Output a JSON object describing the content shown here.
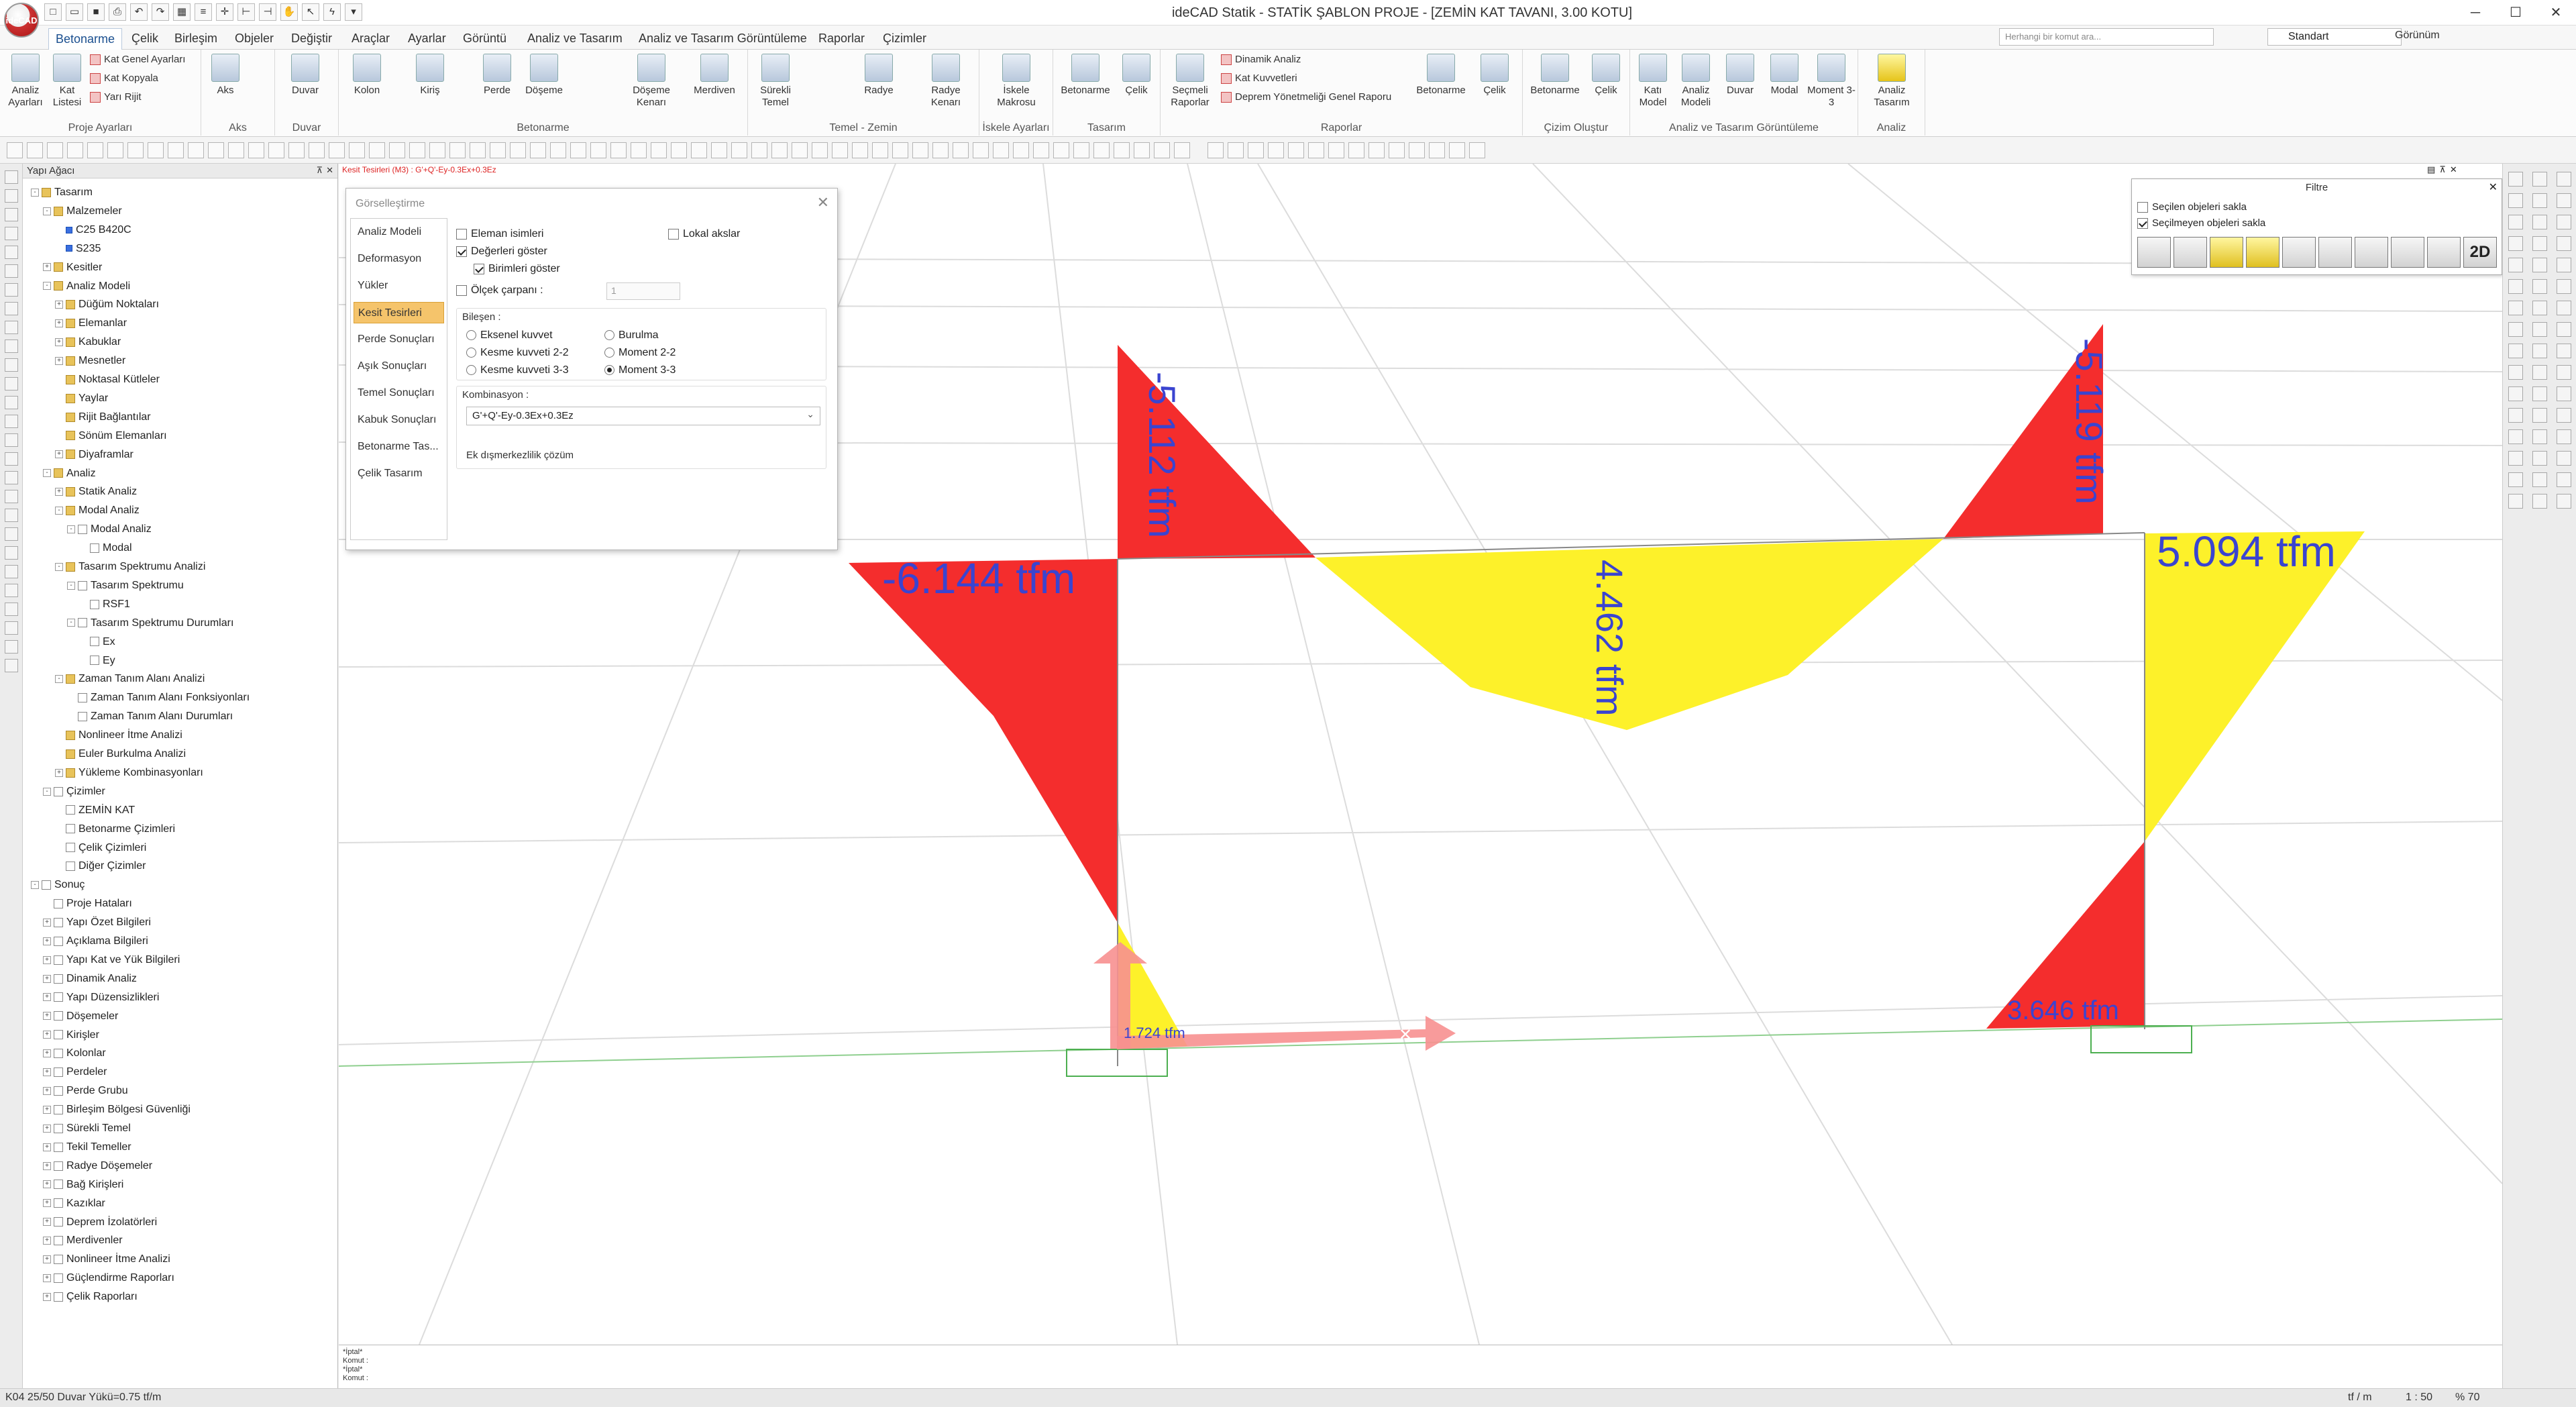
{
  "app": {
    "title": "ideCAD Statik - STATİK ŞABLON PROJE - [ZEMİN KAT TAVANI,  3.00 KOTU]",
    "logo_text": "ideCAD"
  },
  "menu": {
    "tabs": [
      "Betonarme",
      "Çelik",
      "Birleşim",
      "Objeler",
      "Değiştir",
      "Araçlar",
      "Ayarlar",
      "Görüntü",
      "Analiz ve Tasarım",
      "Analiz ve Tasarım Görüntüleme",
      "Raporlar",
      "Çizimler"
    ],
    "active": "Betonarme",
    "search_placeholder": "Herhangi bir komut ara...",
    "profile": "Standart",
    "view_label": "Görünüm"
  },
  "ribbon": {
    "groups": [
      {
        "label": "Proje Ayarları",
        "buttons": [
          "Analiz Ayarları",
          "Kat Listesi"
        ],
        "small": [
          "Kat Genel Ayarları",
          "Kat Kopyala",
          "Yarı Rijit"
        ]
      },
      {
        "label": "Aks",
        "buttons": [
          "Aks"
        ]
      },
      {
        "label": "Duvar",
        "buttons": [
          "Duvar"
        ]
      },
      {
        "label": "Betonarme",
        "buttons": [
          "Kolon",
          "Kiriş",
          "Perde",
          "Döşeme",
          "Döşeme Kenarı",
          "Merdiven"
        ]
      },
      {
        "label": "Temel - Zemin",
        "buttons": [
          "Sürekli Temel",
          "Radye",
          "Radye Kenarı"
        ]
      },
      {
        "label": "İskele Ayarları",
        "buttons": [
          "İskele Makrosu"
        ]
      },
      {
        "label": "Tasarım",
        "buttons": [
          "Betonarme",
          "Çelik"
        ]
      },
      {
        "label": "Raporlar",
        "buttons": [
          "Seçmeli Raporlar",
          "Betonarme",
          "Çelik"
        ],
        "small": [
          "Dinamik Analiz",
          "Kat Kuvvetleri",
          "Deprem Yönetmeliği Genel Raporu"
        ]
      },
      {
        "label": "Çizim Oluştur",
        "buttons": [
          "Betonarme",
          "Çelik"
        ]
      },
      {
        "label": "Analiz ve Tasarım Görüntüleme",
        "buttons": [
          "Katı Model",
          "Analiz Modeli",
          "Duvar",
          "Modal",
          "Moment 3-3"
        ]
      },
      {
        "label": "Analiz",
        "buttons": [
          "Analiz Tasarım"
        ]
      }
    ]
  },
  "tree": {
    "title": "Yapı Ağacı",
    "items": [
      {
        "label": "Tasarım",
        "level": 0,
        "toggle": "-",
        "icon": "folder"
      },
      {
        "label": "Malzemeler",
        "level": 1,
        "toggle": "-",
        "icon": "folder"
      },
      {
        "label": "C25 B420C",
        "level": 2,
        "toggle": "",
        "icon": "blue"
      },
      {
        "label": "S235",
        "level": 2,
        "toggle": "",
        "icon": "blue"
      },
      {
        "label": "Kesitler",
        "level": 1,
        "toggle": "+",
        "icon": "folder"
      },
      {
        "label": "Analiz Modeli",
        "level": 1,
        "toggle": "-",
        "icon": "folder"
      },
      {
        "label": "Düğüm Noktaları",
        "level": 2,
        "toggle": "+",
        "icon": "folder"
      },
      {
        "label": "Elemanlar",
        "level": 2,
        "toggle": "+",
        "icon": "folder"
      },
      {
        "label": "Kabuklar",
        "level": 2,
        "toggle": "+",
        "icon": "folder"
      },
      {
        "label": "Mesnetler",
        "level": 2,
        "toggle": "+",
        "icon": "folder"
      },
      {
        "label": "Noktasal Kütleler",
        "level": 2,
        "toggle": "",
        "icon": "folder"
      },
      {
        "label": "Yaylar",
        "level": 2,
        "toggle": "",
        "icon": "folder"
      },
      {
        "label": "Rijit Bağlantılar",
        "level": 2,
        "toggle": "",
        "icon": "folder"
      },
      {
        "label": "Sönüm Elemanları",
        "level": 2,
        "toggle": "",
        "icon": "folder"
      },
      {
        "label": "Diyaframlar",
        "level": 2,
        "toggle": "+",
        "icon": "folder"
      },
      {
        "label": "Analiz",
        "level": 1,
        "toggle": "-",
        "icon": "folder"
      },
      {
        "label": "Statik Analiz",
        "level": 2,
        "toggle": "+",
        "icon": "folder"
      },
      {
        "label": "Modal Analiz",
        "level": 2,
        "toggle": "-",
        "icon": "folder"
      },
      {
        "label": "Modal Analiz",
        "level": 3,
        "toggle": "-",
        "icon": "doc"
      },
      {
        "label": "Modal",
        "level": 4,
        "toggle": "",
        "icon": "doc"
      },
      {
        "label": "Tasarım Spektrumu Analizi",
        "level": 2,
        "toggle": "-",
        "icon": "folder"
      },
      {
        "label": "Tasarım Spektrumu",
        "level": 3,
        "toggle": "-",
        "icon": "doc"
      },
      {
        "label": "RSF1",
        "level": 4,
        "toggle": "",
        "icon": "doc"
      },
      {
        "label": "Tasarım Spektrumu Durumları",
        "level": 3,
        "toggle": "-",
        "icon": "doc"
      },
      {
        "label": "Ex",
        "level": 4,
        "toggle": "",
        "icon": "doc"
      },
      {
        "label": "Ey",
        "level": 4,
        "toggle": "",
        "icon": "doc"
      },
      {
        "label": "Zaman Tanım Alanı Analizi",
        "level": 2,
        "toggle": "-",
        "icon": "folder"
      },
      {
        "label": "Zaman Tanım Alanı Fonksiyonları",
        "level": 3,
        "toggle": "",
        "icon": "doc"
      },
      {
        "label": "Zaman Tanım Alanı Durumları",
        "level": 3,
        "toggle": "",
        "icon": "doc"
      },
      {
        "label": "Nonlineer İtme Analizi",
        "level": 2,
        "toggle": "",
        "icon": "folder"
      },
      {
        "label": "Euler Burkulma Analizi",
        "level": 2,
        "toggle": "",
        "icon": "folder"
      },
      {
        "label": "Yükleme Kombinasyonları",
        "level": 2,
        "toggle": "+",
        "icon": "folder"
      },
      {
        "label": "Çizimler",
        "level": 1,
        "toggle": "-",
        "icon": "doc"
      },
      {
        "label": "ZEMİN KAT",
        "level": 2,
        "toggle": "",
        "icon": "doc"
      },
      {
        "label": "Betonarme Çizimleri",
        "level": 2,
        "toggle": "",
        "icon": "doc"
      },
      {
        "label": "Çelik Çizimleri",
        "level": 2,
        "toggle": "",
        "icon": "doc"
      },
      {
        "label": "Diğer Çizimler",
        "level": 2,
        "toggle": "",
        "icon": "doc"
      },
      {
        "label": "Sonuç",
        "level": 0,
        "toggle": "-",
        "icon": "doc"
      },
      {
        "label": "Proje Hataları",
        "level": 1,
        "toggle": "",
        "icon": "doc"
      },
      {
        "label": "Yapı Özet Bilgileri",
        "level": 1,
        "toggle": "+",
        "icon": "doc"
      },
      {
        "label": "Açıklama Bilgileri",
        "level": 1,
        "toggle": "+",
        "icon": "doc"
      },
      {
        "label": "Yapı Kat ve Yük Bilgileri",
        "level": 1,
        "toggle": "+",
        "icon": "doc"
      },
      {
        "label": "Dinamik Analiz",
        "level": 1,
        "toggle": "+",
        "icon": "doc"
      },
      {
        "label": "Yapı Düzensizlikleri",
        "level": 1,
        "toggle": "+",
        "icon": "doc"
      },
      {
        "label": "Döşemeler",
        "level": 1,
        "toggle": "+",
        "icon": "doc"
      },
      {
        "label": "Kirişler",
        "level": 1,
        "toggle": "+",
        "icon": "doc"
      },
      {
        "label": "Kolonlar",
        "level": 1,
        "toggle": "+",
        "icon": "doc"
      },
      {
        "label": "Perdeler",
        "level": 1,
        "toggle": "+",
        "icon": "doc"
      },
      {
        "label": "Perde Grubu",
        "level": 1,
        "toggle": "+",
        "icon": "doc"
      },
      {
        "label": "Birleşim Bölgesi Güvenliği",
        "level": 1,
        "toggle": "+",
        "icon": "doc"
      },
      {
        "label": "Sürekli Temel",
        "level": 1,
        "toggle": "+",
        "icon": "doc"
      },
      {
        "label": "Tekil Temeller",
        "level": 1,
        "toggle": "+",
        "icon": "doc"
      },
      {
        "label": "Radye Döşemeler",
        "level": 1,
        "toggle": "+",
        "icon": "doc"
      },
      {
        "label": "Bağ Kirişleri",
        "level": 1,
        "toggle": "+",
        "icon": "doc"
      },
      {
        "label": "Kazıklar",
        "level": 1,
        "toggle": "+",
        "icon": "doc"
      },
      {
        "label": "Deprem İzolatörleri",
        "level": 1,
        "toggle": "+",
        "icon": "doc"
      },
      {
        "label": "Merdivenler",
        "level": 1,
        "toggle": "+",
        "icon": "doc"
      },
      {
        "label": "Nonlineer İtme Analizi",
        "level": 1,
        "toggle": "+",
        "icon": "doc"
      },
      {
        "label": "Güçlendirme Raporları",
        "level": 1,
        "toggle": "+",
        "icon": "doc"
      },
      {
        "label": "Çelik Raporları",
        "level": 1,
        "toggle": "+",
        "icon": "doc"
      }
    ]
  },
  "view": {
    "tag": "Kesit Tesirleri (M3) : G'+Q'-Ey-0.3Ex+0.3Ez",
    "labels": {
      "left_column_top": "-6.144 tfm",
      "left_column_bottom": "1.724 tfm",
      "beam_left_end": "-5.112 tfm",
      "beam_mid": "4.462 tfm",
      "beam_right_end": "-5.119 tfm",
      "right_column_top": "5.094 tfm",
      "right_column_bottom": "3.646 tfm"
    },
    "colors": {
      "negative": "#f42d2d",
      "positive": "#fdf12a",
      "label": "#3a44d0",
      "arrow": "#f79090"
    }
  },
  "dialog": {
    "title": "Görselleştirme",
    "nav": [
      "Analiz Modeli",
      "Deformasyon",
      "Yükler",
      "Kesit Tesirleri",
      "Perde Sonuçları",
      "Aşık Sonuçları",
      "Temel Sonuçları",
      "Kabuk Sonuçları",
      "Betonarme Tas...",
      "Çelik Tasarım"
    ],
    "nav_selected": "Kesit Tesirleri",
    "opt_element_names": "Eleman isimleri",
    "opt_show_values": "Değerleri göster",
    "opt_show_units": "Birimleri göster",
    "opt_local_axes": "Lokal akslar",
    "opt_scale": "Ölçek çarpanı :",
    "scale_value": "1",
    "component_label": "Bileşen :",
    "components": [
      "Eksenel kuvvet",
      "Kesme kuvveti 2-2",
      "Kesme kuvveti 3-3",
      "Burulma",
      "Moment 2-2",
      "Moment 3-3"
    ],
    "component_selected": "Moment 3-3",
    "combination_label": "Kombinasyon :",
    "combination_value": "G'+Q'-Ey-0.3Ex+0.3Ez",
    "eccentric_label": "Ek dışmerkezlilik çözüm"
  },
  "filter": {
    "title": "Filtre",
    "hide_selected": "Seçilen objeleri sakla",
    "hide_unselected": "Seçilmeyen objeleri sakla",
    "mode": "2D"
  },
  "command": {
    "lines": [
      "*İptal*",
      "Komut :",
      "*İptal*",
      "Komut :"
    ]
  },
  "status": {
    "left": "K04 25/50 Duvar Yükü=0.75 tf/m",
    "unit": "tf / m",
    "scale": "1 : 50",
    "zoom": "% 70"
  }
}
